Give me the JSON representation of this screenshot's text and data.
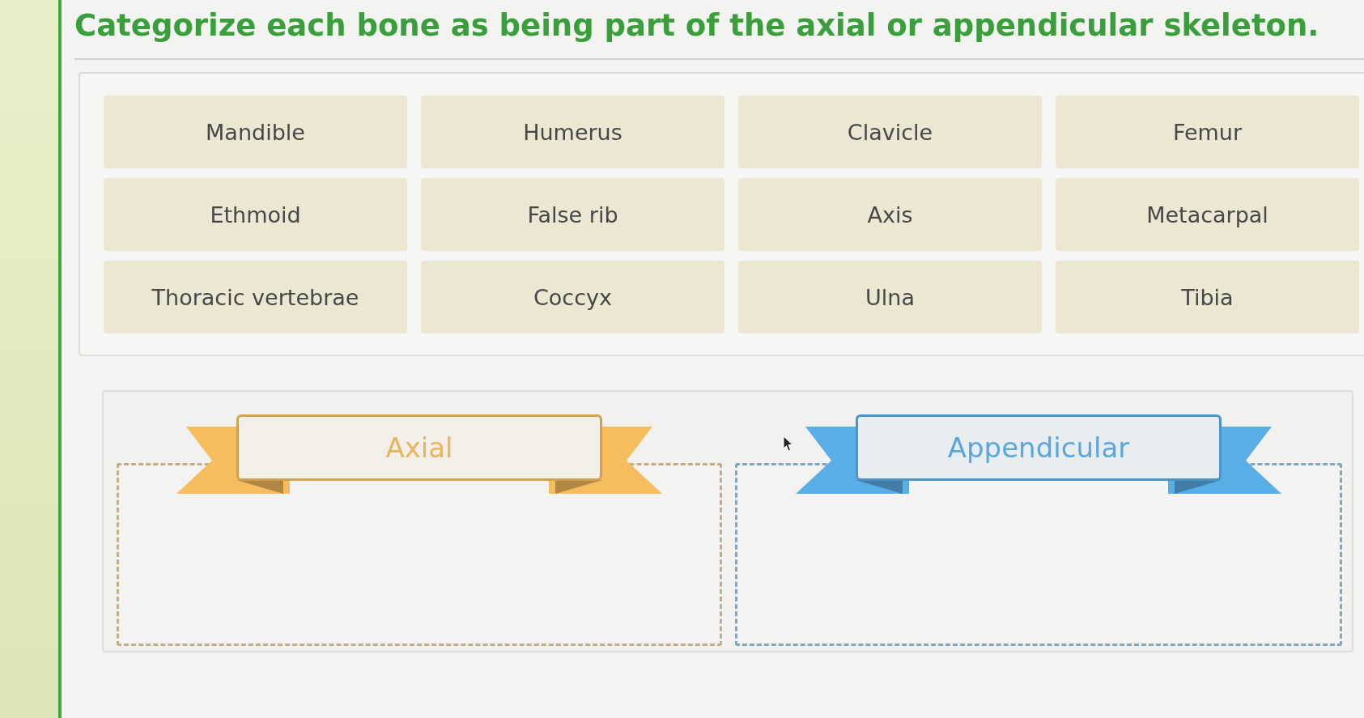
{
  "title": "Categorize each bone as being part of the axial or appendicular skeleton.",
  "bones": [
    "Mandible",
    "Humerus",
    "Clavicle",
    "Femur",
    "Ethmoid",
    "False rib",
    "Axis",
    "Metacarpal",
    "Thoracic vertebrae",
    "Coccyx",
    "Ulna",
    "Tibia"
  ],
  "categories": [
    {
      "label": "Axial",
      "color": "#f5bd5e"
    },
    {
      "label": "Appendicular",
      "color": "#5aaee6"
    }
  ]
}
